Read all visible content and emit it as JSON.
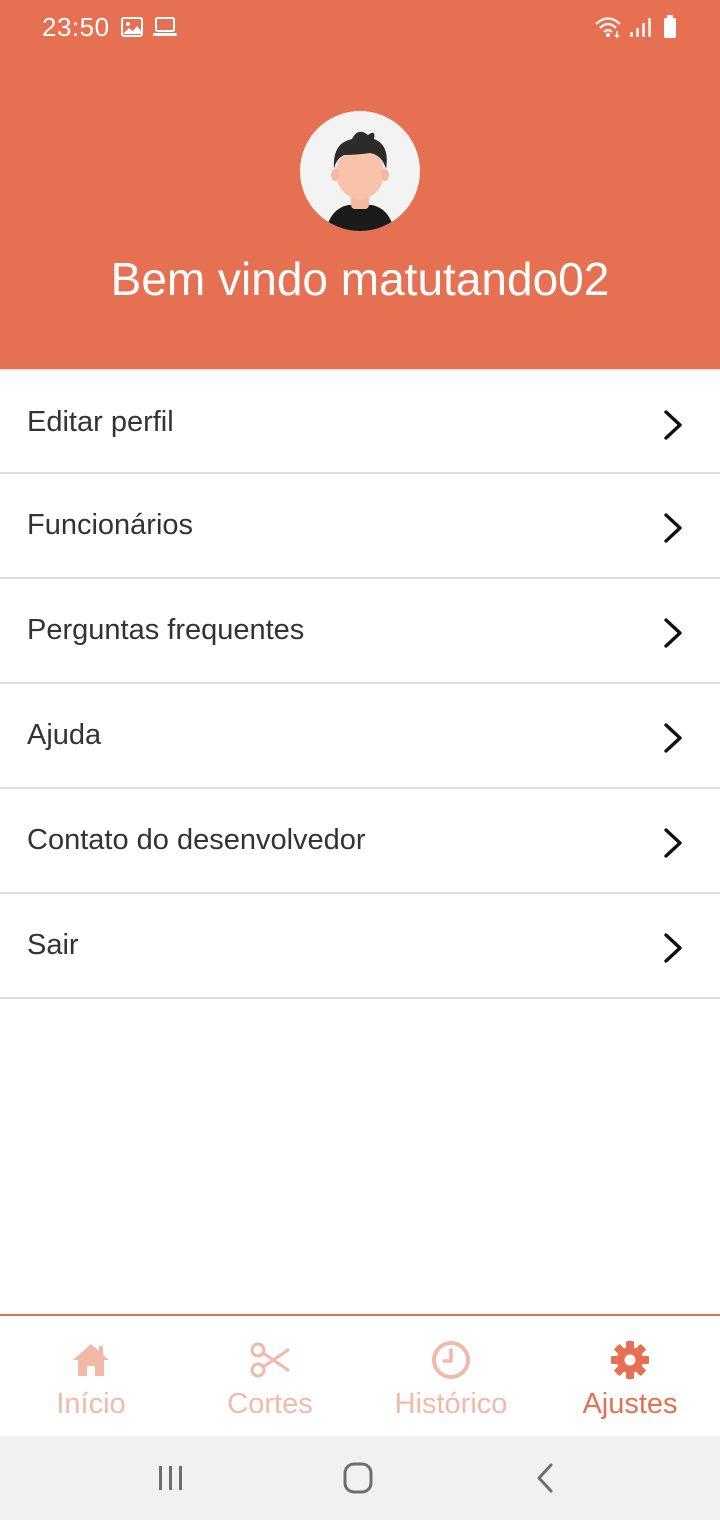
{
  "status_bar": {
    "time": "23:50",
    "icons": [
      "image-icon",
      "laptop-icon",
      "wifi-icon",
      "signal-icon",
      "battery-icon"
    ]
  },
  "header": {
    "welcome_text": "Bem vindo matutando02",
    "avatar_icon": "user-avatar-icon",
    "background_color": "#E67052"
  },
  "menu": {
    "items": [
      {
        "label": "Editar perfil",
        "icon": "chevron-right-icon"
      },
      {
        "label": "Funcionários",
        "icon": "chevron-right-icon"
      },
      {
        "label": "Perguntas frequentes",
        "icon": "chevron-right-icon"
      },
      {
        "label": "Ajuda",
        "icon": "chevron-right-icon"
      },
      {
        "label": "Contato do desenvolvedor",
        "icon": "chevron-right-icon"
      },
      {
        "label": "Sair",
        "icon": "chevron-right-icon"
      }
    ]
  },
  "tab_bar": {
    "accent_color": "#E67052",
    "inactive_color": "#F2B9A9",
    "active_tab": "Ajustes",
    "tabs": [
      {
        "label": "Início",
        "icon": "home-icon"
      },
      {
        "label": "Cortes",
        "icon": "scissors-icon"
      },
      {
        "label": "Histórico",
        "icon": "clock-icon"
      },
      {
        "label": "Ajustes",
        "icon": "gear-icon"
      }
    ]
  },
  "system_nav": {
    "buttons": [
      "recent-apps-icon",
      "home-button-icon",
      "back-icon"
    ]
  }
}
